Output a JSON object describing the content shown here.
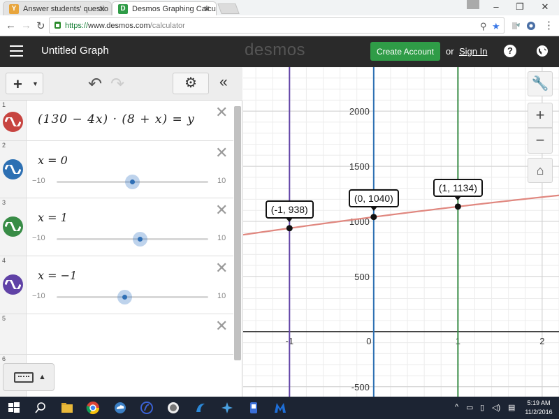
{
  "browser": {
    "tabs": [
      {
        "title": "Answer students' questio",
        "icon": "yahoo-answers-icon",
        "icon_color": "#e8a53c"
      },
      {
        "title": "Desmos Graphing Calcula",
        "icon": "desmos-icon",
        "icon_color": "#2f9c47"
      }
    ],
    "url_prefix": "https://",
    "url_host": "www.desmos.com",
    "url_path": "/calculator"
  },
  "header": {
    "title": "Untitled Graph",
    "brand": "desmos",
    "create_account": "Create Account",
    "or_text": "or",
    "sign_in": "Sign In"
  },
  "expressions": [
    {
      "num": "1",
      "latex": "(130 − 4x) · (8 + x) = y",
      "color": "#c74440"
    },
    {
      "num": "2",
      "latex": "x = 0",
      "color": "#2d70b3",
      "slider": {
        "min": "−10",
        "max": "10",
        "value": 0
      }
    },
    {
      "num": "3",
      "latex": "x = 1",
      "color": "#388c46",
      "slider": {
        "min": "−10",
        "max": "10",
        "value": 1
      }
    },
    {
      "num": "4",
      "latex": "x = −1",
      "color": "#6042a6",
      "slider": {
        "min": "−10",
        "max": "10",
        "value": -1
      }
    },
    {
      "num": "5"
    },
    {
      "num": "6"
    }
  ],
  "graph": {
    "xlim": [
      -1.55,
      2.2
    ],
    "ylim": [
      -590,
      2400
    ],
    "x_ticks": [
      {
        "v": -1,
        "label": "-1"
      },
      {
        "v": 0,
        "label": "0"
      },
      {
        "v": 1,
        "label": "1"
      },
      {
        "v": 2,
        "label": "2"
      }
    ],
    "y_ticks": [
      {
        "v": -500,
        "label": "-500"
      },
      {
        "v": 500,
        "label": "500"
      },
      {
        "v": 1000,
        "label": "1000"
      },
      {
        "v": 1500,
        "label": "1500"
      },
      {
        "v": 2000,
        "label": "2000"
      }
    ],
    "curve_color": "#e0877f",
    "vertical_lines": [
      {
        "x": -1,
        "color": "#6042a6"
      },
      {
        "x": 0,
        "color": "#2d70b3"
      },
      {
        "x": 1,
        "color": "#388c46"
      }
    ],
    "points": [
      {
        "x": -1,
        "y": 938,
        "label": "(-1, 938)"
      },
      {
        "x": 0,
        "y": 1040,
        "label": "(0, 1040)"
      },
      {
        "x": 1,
        "y": 1134,
        "label": "(1, 1134)"
      }
    ]
  },
  "taskbar": {
    "time": "5:19 AM",
    "date": "11/2/2016"
  }
}
